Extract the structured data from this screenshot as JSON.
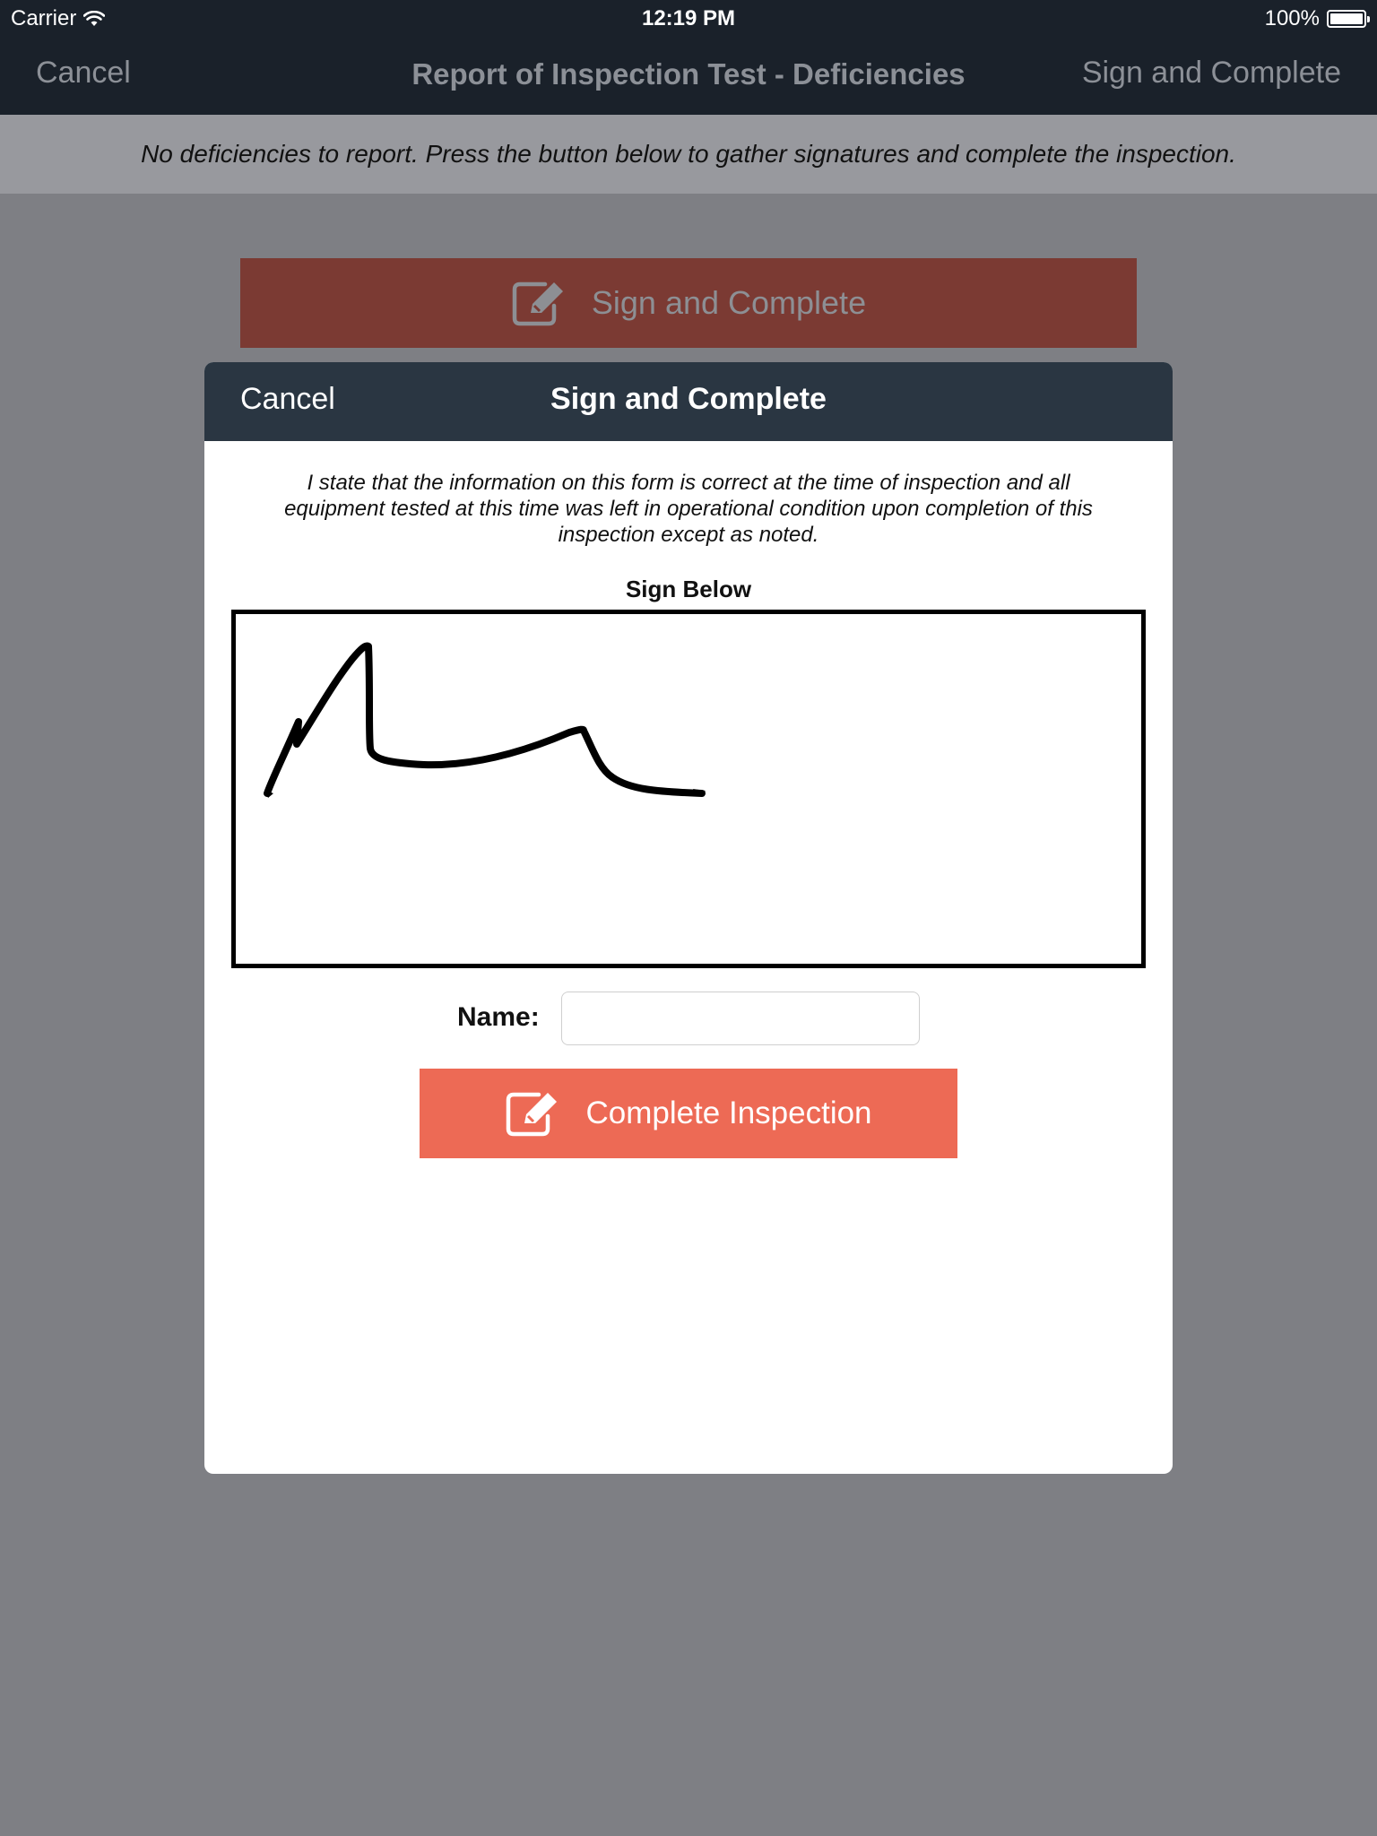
{
  "status_bar": {
    "carrier": "Carrier",
    "time": "12:19 PM",
    "battery": "100%",
    "wifi_icon": "wifi-icon",
    "battery_icon": "battery-icon"
  },
  "nav": {
    "cancel_label": "Cancel",
    "title": "Report of Inspection Test - Deficiencies",
    "right_label": "Sign and Complete"
  },
  "notice": {
    "text": "No deficiencies to report.  Press the button below to gather signatures and complete the inspection."
  },
  "background_button": {
    "label": "Sign and Complete",
    "icon": "edit-icon"
  },
  "modal": {
    "cancel_label": "Cancel",
    "title": "Sign and Complete",
    "statement": "I state that the information on this form is correct at the time of inspection and all equipment tested at this time was left in operational condition upon completion of this inspection except as noted.",
    "sign_below_label": "Sign Below",
    "name_label": "Name:",
    "name_value": "",
    "name_placeholder": "",
    "complete_button_label": "Complete Inspection",
    "complete_button_icon": "edit-icon"
  },
  "colors": {
    "nav_background": "#1a212a",
    "modal_header": "#2a3642",
    "overlay": "#7e7f84",
    "primary_button": "#ed6a55",
    "dimmed_button": "#7b3a33"
  }
}
